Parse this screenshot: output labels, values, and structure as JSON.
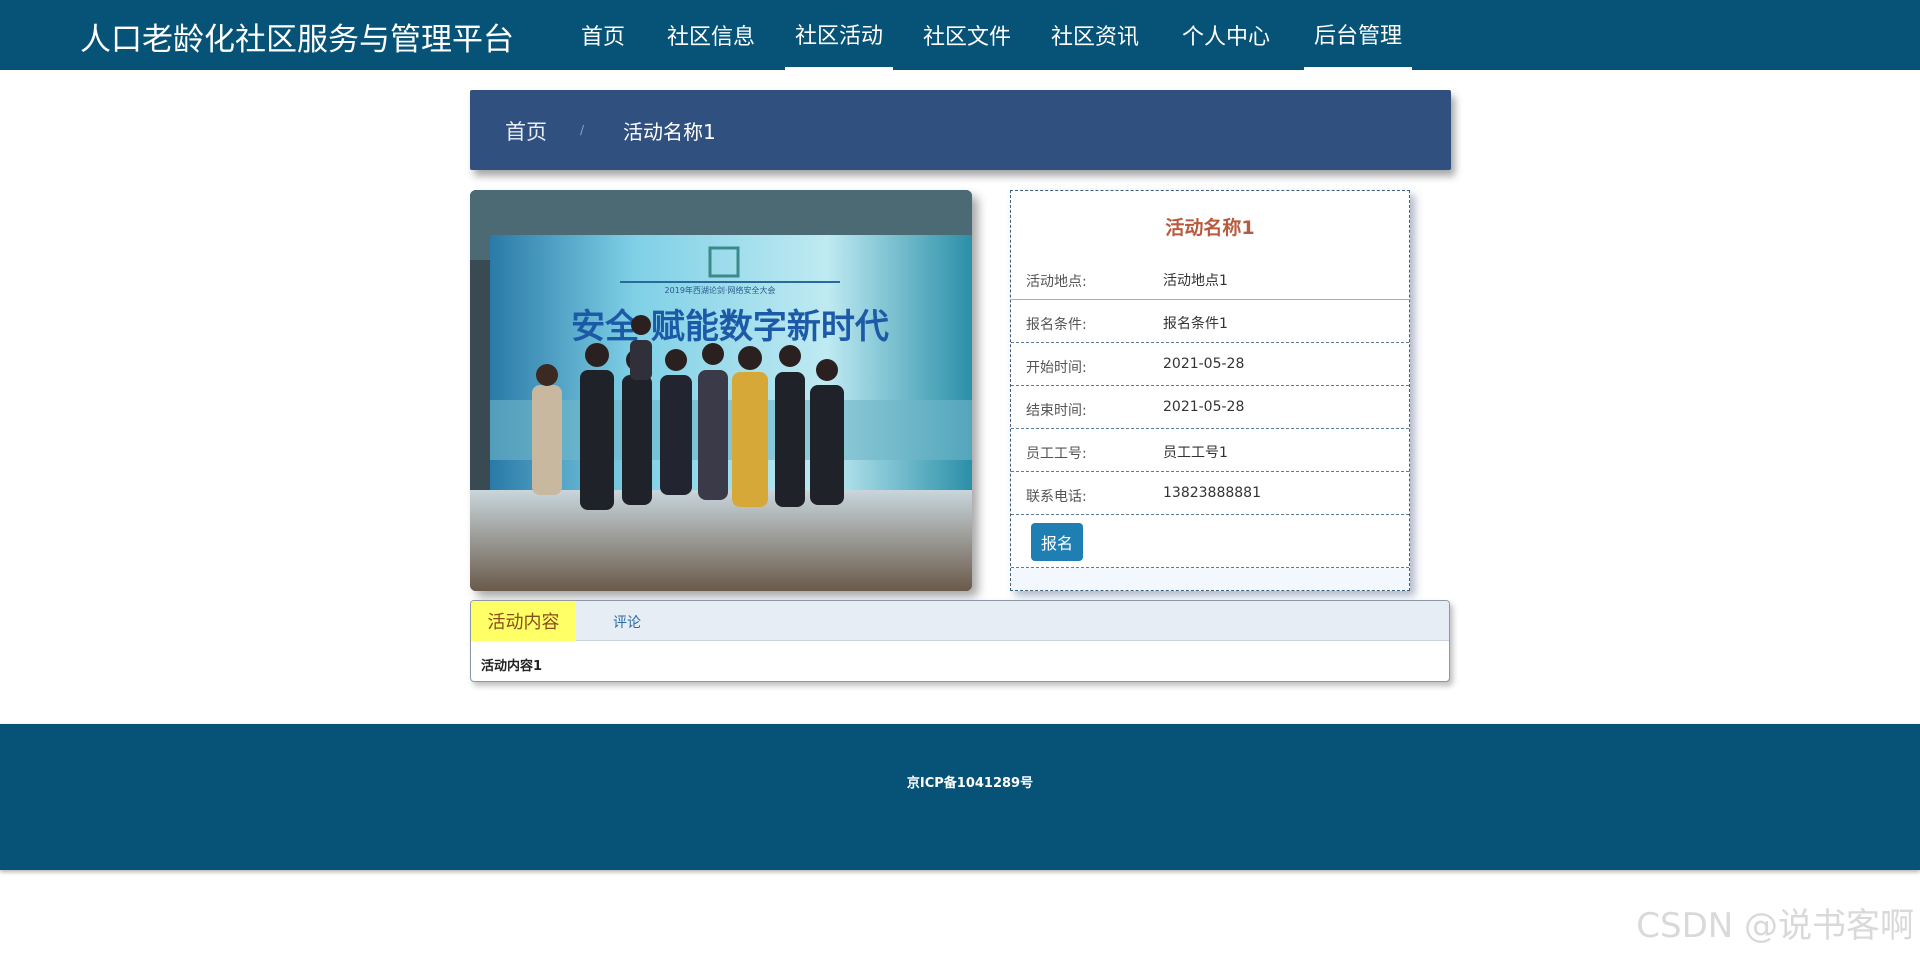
{
  "header": {
    "site_title": "人口老龄化社区服务与管理平台",
    "nav": [
      {
        "label": "首页"
      },
      {
        "label": "社区信息"
      },
      {
        "label": "社区活动"
      },
      {
        "label": "社区文件"
      },
      {
        "label": "社区资讯"
      },
      {
        "label": "个人中心"
      },
      {
        "label": "后台管理"
      }
    ]
  },
  "breadcrumb": {
    "home": "首页",
    "separator": "/",
    "current": "活动名称1"
  },
  "photo": {
    "banner_text": "安全 赋能数字新时代",
    "banner_subtitle": "2019年西湖论剑·网络安全大会"
  },
  "detail": {
    "title": "活动名称1",
    "rows": [
      {
        "label": "活动地点:",
        "value": "活动地点1"
      },
      {
        "label": "报名条件:",
        "value": "报名条件1"
      },
      {
        "label": "开始时间:",
        "value": "2021-05-28"
      },
      {
        "label": "结束时间:",
        "value": "2021-05-28"
      },
      {
        "label": "员工工号:",
        "value": "员工工号1"
      },
      {
        "label": "联系电话:",
        "value": "13823888881"
      }
    ],
    "signup_button": "报名"
  },
  "tabs": {
    "active": "活动内容",
    "other": "评论",
    "content": "活动内容1"
  },
  "footer": {
    "icp": "京ICP备1041289号"
  },
  "watermark": "CSDN @说书客啊",
  "colors": {
    "brand": "#075377",
    "breadcrumb_bg": "#30507f",
    "accent_title": "#b85a3d",
    "button": "#1f7fb3",
    "active_tab": "#ffff66"
  }
}
